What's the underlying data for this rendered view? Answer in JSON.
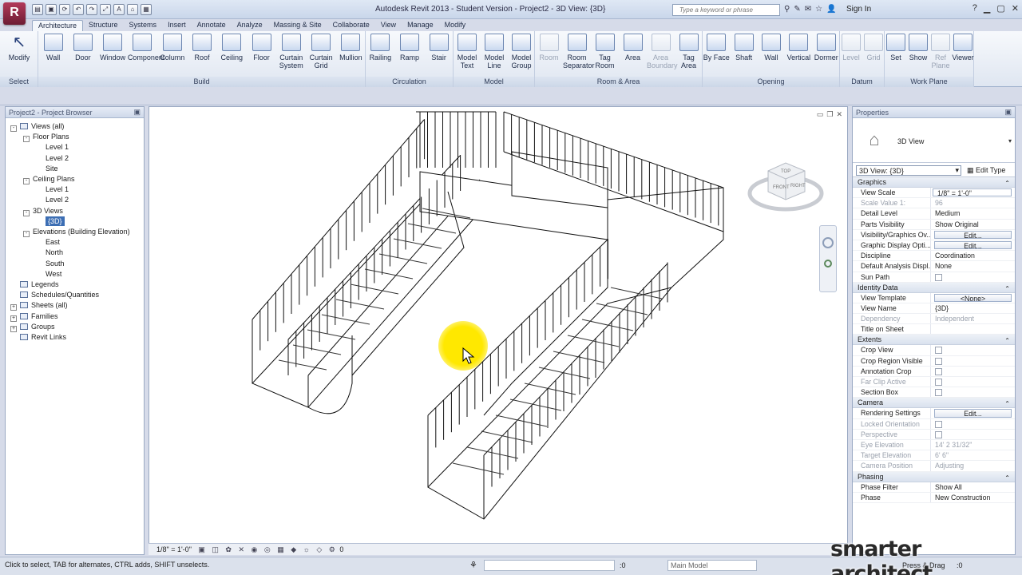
{
  "titlebar": {
    "app_button": "R",
    "title": "Autodesk Revit 2013 - Student Version -   Project2 - 3D View: {3D}",
    "search_placeholder": "Type a keyword or phrase",
    "signin": "Sign In",
    "qat_icons": [
      "open-icon",
      "save-icon",
      "sync-icon",
      "undo-icon",
      "redo-icon",
      "measure-icon",
      "text-icon",
      "3d-icon",
      "close-views-icon"
    ]
  },
  "tabs": [
    "Architecture",
    "Structure",
    "Systems",
    "Insert",
    "Annotate",
    "Analyze",
    "Massing & Site",
    "Collaborate",
    "View",
    "Manage",
    "Modify"
  ],
  "ribbon": {
    "select": {
      "label": "Select",
      "tools": [
        "Modify"
      ]
    },
    "build": {
      "label": "Build",
      "tools": [
        "Wall",
        "Door",
        "Window",
        "Component",
        "Column",
        "Roof",
        "Ceiling",
        "Floor",
        "Curtain System",
        "Curtain Grid",
        "Mullion"
      ]
    },
    "circulation": {
      "label": "Circulation",
      "tools": [
        "Railing",
        "Ramp",
        "Stair"
      ]
    },
    "model": {
      "label": "Model",
      "tools": [
        "Model Text",
        "Model Line",
        "Model Group"
      ]
    },
    "room_area": {
      "label": "Room & Area",
      "tools": [
        "Room",
        "Room Separator",
        "Tag Room",
        "Area",
        "Area Boundary",
        "Tag Area"
      ]
    },
    "opening": {
      "label": "Opening",
      "tools": [
        "By Face",
        "Shaft",
        "Wall",
        "Vertical",
        "Dormer"
      ]
    },
    "datum": {
      "label": "Datum",
      "tools": [
        "Level",
        "Grid"
      ]
    },
    "work_plane": {
      "label": "Work Plane",
      "tools": [
        "Set",
        "Show",
        "Ref Plane",
        "Viewer"
      ]
    }
  },
  "browser": {
    "title": "Project2 - Project Browser",
    "rows": [
      {
        "t": "Views (all)",
        "lvl": 0,
        "exp": "-",
        "icon": true
      },
      {
        "t": "Floor Plans",
        "lvl": 1,
        "exp": "-"
      },
      {
        "t": "Level 1",
        "lvl": 2
      },
      {
        "t": "Level 2",
        "lvl": 2
      },
      {
        "t": "Site",
        "lvl": 2
      },
      {
        "t": "Ceiling Plans",
        "lvl": 1,
        "exp": "-"
      },
      {
        "t": "Level 1",
        "lvl": 2
      },
      {
        "t": "Level 2",
        "lvl": 2
      },
      {
        "t": "3D Views",
        "lvl": 1,
        "exp": "-"
      },
      {
        "t": "{3D}",
        "lvl": 2,
        "sel": true
      },
      {
        "t": "Elevations (Building Elevation)",
        "lvl": 1,
        "exp": "-"
      },
      {
        "t": "East",
        "lvl": 2
      },
      {
        "t": "North",
        "lvl": 2
      },
      {
        "t": "South",
        "lvl": 2
      },
      {
        "t": "West",
        "lvl": 2
      },
      {
        "t": "Legends",
        "lvl": 0,
        "icon": true
      },
      {
        "t": "Schedules/Quantities",
        "lvl": 0,
        "icon": true
      },
      {
        "t": "Sheets (all)",
        "lvl": 0,
        "exp": "+",
        "icon": true
      },
      {
        "t": "Families",
        "lvl": 0,
        "exp": "+",
        "icon": true
      },
      {
        "t": "Groups",
        "lvl": 0,
        "exp": "+",
        "icon": true
      },
      {
        "t": "Revit Links",
        "lvl": 0,
        "icon": true
      }
    ]
  },
  "viewbar": {
    "scale": "1/8\" = 1'-0\"",
    "extra": "0"
  },
  "viewcube": {
    "front": "FRONT",
    "right": "RIGHT",
    "top": "TOP"
  },
  "properties": {
    "title": "Properties",
    "type_name": "3D View",
    "instance": "3D View: {3D}",
    "edit_type": "Edit Type",
    "groups": [
      {
        "name": "Graphics",
        "rows": [
          [
            "View Scale",
            "1/8\" = 1'-0\"",
            "input"
          ],
          [
            "Scale Value  1:",
            "96",
            "dis"
          ],
          [
            "Detail Level",
            "Medium",
            ""
          ],
          [
            "Parts Visibility",
            "Show Original",
            ""
          ],
          [
            "Visibility/Graphics Ov...",
            "Edit...",
            "btn"
          ],
          [
            "Graphic Display Opti...",
            "Edit...",
            "btn"
          ],
          [
            "Discipline",
            "Coordination",
            ""
          ],
          [
            "Default Analysis Displ...",
            "None",
            ""
          ],
          [
            "Sun Path",
            "",
            "chk"
          ]
        ]
      },
      {
        "name": "Identity Data",
        "rows": [
          [
            "View Template",
            "<None>",
            "btn"
          ],
          [
            "View Name",
            "{3D}",
            ""
          ],
          [
            "Dependency",
            "Independent",
            "dis"
          ],
          [
            "Title on Sheet",
            "",
            ""
          ]
        ]
      },
      {
        "name": "Extents",
        "rows": [
          [
            "Crop View",
            "",
            "chk"
          ],
          [
            "Crop Region Visible",
            "",
            "chk"
          ],
          [
            "Annotation Crop",
            "",
            "chk"
          ],
          [
            "Far Clip Active",
            "",
            "chkdis"
          ],
          [
            "Section Box",
            "",
            "chk"
          ]
        ]
      },
      {
        "name": "Camera",
        "rows": [
          [
            "Rendering Settings",
            "Edit...",
            "btn"
          ],
          [
            "Locked Orientation",
            "",
            "chkdis"
          ],
          [
            "Perspective",
            "",
            "chkdis"
          ],
          [
            "Eye Elevation",
            "14'  2 31/32\"",
            "dis"
          ],
          [
            "Target Elevation",
            "6'  6\"",
            "dis"
          ],
          [
            "Camera Position",
            "Adjusting",
            "dis"
          ]
        ]
      },
      {
        "name": "Phasing",
        "rows": [
          [
            "Phase Filter",
            "Show All",
            ""
          ],
          [
            "Phase",
            "New Construction",
            ""
          ]
        ]
      }
    ]
  },
  "status": {
    "text": "Click to select, TAB for alternates, CTRL adds, SHIFT unselects.",
    "coord": ":0",
    "workset": "Main Model",
    "press_drag": "Press & Drag",
    "filter": ":0"
  },
  "watermark": "smarter architect"
}
